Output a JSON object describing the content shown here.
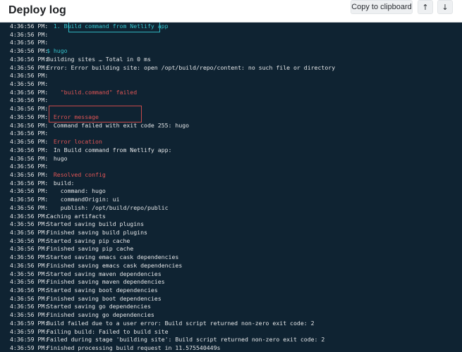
{
  "header": {
    "title": "Deploy log",
    "copy_label": "Copy to clipboard",
    "up_icon": "arrow-up-icon",
    "down_icon": "arrow-down-icon",
    "up_glyph": "↑",
    "down_glyph": "↓"
  },
  "log": {
    "lines": [
      {
        "ts": "4:36:56 PM:",
        "text": "  1. Build command from Netlify app",
        "color": "cyan"
      },
      {
        "ts": "4:36:56 PM:",
        "text": "",
        "color": "white"
      },
      {
        "ts": "4:36:56 PM:",
        "text": "",
        "color": "white"
      },
      {
        "ts": "4:36:56 PM:",
        "text": "$ hugo",
        "color": "cyan"
      },
      {
        "ts": "4:36:56 PM:",
        "text": "Building sites … Total in 0 ms",
        "color": "white"
      },
      {
        "ts": "4:36:56 PM:",
        "text": "Error: Error building site: open /opt/build/repo/content: no such file or directory",
        "color": "white"
      },
      {
        "ts": "4:36:56 PM:",
        "text": "",
        "color": "white"
      },
      {
        "ts": "4:36:56 PM:",
        "text": "",
        "color": "white"
      },
      {
        "ts": "4:36:56 PM:",
        "text": "    \"build.command\" failed",
        "color": "red"
      },
      {
        "ts": "4:36:56 PM:",
        "text": "",
        "color": "white"
      },
      {
        "ts": "4:36:56 PM:",
        "text": "",
        "color": "white"
      },
      {
        "ts": "4:36:56 PM:",
        "text": "  Error message",
        "color": "red"
      },
      {
        "ts": "4:36:56 PM:",
        "text": "  Command failed with exit code 255: hugo",
        "color": "white"
      },
      {
        "ts": "4:36:56 PM:",
        "text": "",
        "color": "white"
      },
      {
        "ts": "4:36:56 PM:",
        "text": "  Error location",
        "color": "red"
      },
      {
        "ts": "4:36:56 PM:",
        "text": "  In Build command from Netlify app:",
        "color": "white"
      },
      {
        "ts": "4:36:56 PM:",
        "text": "  hugo",
        "color": "white"
      },
      {
        "ts": "4:36:56 PM:",
        "text": "",
        "color": "white"
      },
      {
        "ts": "4:36:56 PM:",
        "text": "  Resolved config",
        "color": "red"
      },
      {
        "ts": "4:36:56 PM:",
        "text": "  build:",
        "color": "white"
      },
      {
        "ts": "4:36:56 PM:",
        "text": "    command: hugo",
        "color": "white"
      },
      {
        "ts": "4:36:56 PM:",
        "text": "    commandOrigin: ui",
        "color": "white"
      },
      {
        "ts": "4:36:56 PM:",
        "text": "    publish: /opt/build/repo/public",
        "color": "white"
      },
      {
        "ts": "4:36:56 PM:",
        "text": "Caching artifacts",
        "color": "white"
      },
      {
        "ts": "4:36:56 PM:",
        "text": "Started saving build plugins",
        "color": "white"
      },
      {
        "ts": "4:36:56 PM:",
        "text": "Finished saving build plugins",
        "color": "white"
      },
      {
        "ts": "4:36:56 PM:",
        "text": "Started saving pip cache",
        "color": "white"
      },
      {
        "ts": "4:36:56 PM:",
        "text": "Finished saving pip cache",
        "color": "white"
      },
      {
        "ts": "4:36:56 PM:",
        "text": "Started saving emacs cask dependencies",
        "color": "white"
      },
      {
        "ts": "4:36:56 PM:",
        "text": "Finished saving emacs cask dependencies",
        "color": "white"
      },
      {
        "ts": "4:36:56 PM:",
        "text": "Started saving maven dependencies",
        "color": "white"
      },
      {
        "ts": "4:36:56 PM:",
        "text": "Finished saving maven dependencies",
        "color": "white"
      },
      {
        "ts": "4:36:56 PM:",
        "text": "Started saving boot dependencies",
        "color": "white"
      },
      {
        "ts": "4:36:56 PM:",
        "text": "Finished saving boot dependencies",
        "color": "white"
      },
      {
        "ts": "4:36:56 PM:",
        "text": "Started saving go dependencies",
        "color": "white"
      },
      {
        "ts": "4:36:56 PM:",
        "text": "Finished saving go dependencies",
        "color": "white"
      },
      {
        "ts": "4:36:59 PM:",
        "text": "Build failed due to a user error: Build script returned non-zero exit code: 2",
        "color": "white"
      },
      {
        "ts": "4:36:59 PM:",
        "text": "Failing build: Failed to build site",
        "color": "white"
      },
      {
        "ts": "4:36:59 PM:",
        "text": "Failed during stage 'building site': Build script returned non-zero exit code: 2",
        "color": "white"
      },
      {
        "ts": "4:36:59 PM:",
        "text": "Finished processing build request in 11.575540449s",
        "color": "white"
      }
    ]
  },
  "colors": {
    "log_background": "#0f2332",
    "cyan": "#35c3cc",
    "red": "#e05555",
    "text": "#e4e6e8"
  }
}
